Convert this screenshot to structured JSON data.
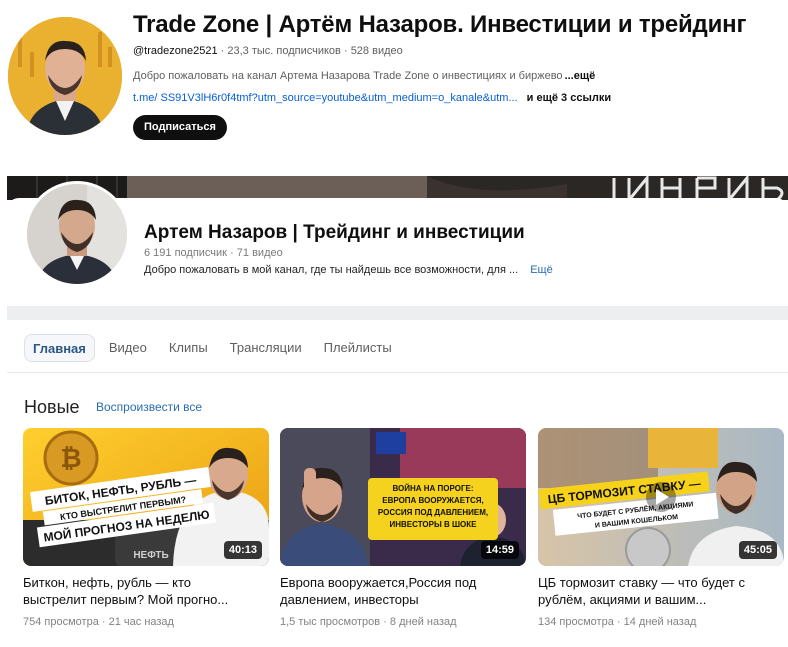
{
  "youtube": {
    "title": "Trade Zone | Артём Назаров. Инвестиции и трейдинг",
    "handle": "@tradezone2521",
    "subscribers": "23,3 тыс. подписчиков",
    "videos": "528 видео",
    "description": "Добро пожаловать на канал Артема Назарова Trade Zone о инвестициях и биржево",
    "more_label": "...ещё",
    "link": "t.me/ SS91V3lH6r0f4tmf?utm_source=youtube&utm_medium=o_kanale&utm...",
    "extra_links": "и ещё 3 ссылки",
    "subscribe_label": "Подписаться"
  },
  "channel": {
    "title": "Артем Назаров | Трейдинг и инвестиции",
    "subscribers": "6 191 подписчик",
    "videos": "71 видео",
    "description": "Добро пожаловать в мой канал, где ты найдешь все возможности, для ...",
    "more_label": "Ещё"
  },
  "tabs": [
    {
      "label": "Главная",
      "active": true
    },
    {
      "label": "Видео",
      "active": false
    },
    {
      "label": "Клипы",
      "active": false
    },
    {
      "label": "Трансляции",
      "active": false
    },
    {
      "label": "Плейлисты",
      "active": false
    }
  ],
  "section": {
    "title": "Новые",
    "play_all": "Воспроизвести все"
  },
  "videos": [
    {
      "title_line1": "Биткон, нефть, рубль — кто",
      "title_line2": "выстрелит первым? Мой прогно...",
      "views": "754 просмотра",
      "date": "21 час назад",
      "duration": "40:13",
      "thumb_text1": "БИТОК, НЕФТЬ, РУБЛЬ —",
      "thumb_text2": "КТО ВЫСТРЕЛИТ ПЕРВЫМ?",
      "thumb_text3": "МОЙ ПРОГНОЗ НА НЕДЕЛЮ",
      "thumb_text4": "НЕФТЬ"
    },
    {
      "title_line1": "Европа вооружается,Россия под",
      "title_line2": "давлением, инвесторы",
      "views": "1,5 тыс просмотров",
      "date": "8 дней назад",
      "duration": "14:59",
      "thumb_text1": "ВОЙНА НА ПОРОГЕ:",
      "thumb_text2": "ЕВРОПА ВООРУЖАЕТСЯ,",
      "thumb_text3": "РОССИЯ ПОД ДАВЛЕНИЕМ,",
      "thumb_text4": "ИНВЕСТОРЫ В ШОКЕ"
    },
    {
      "title_line1": "ЦБ тормозит ставку — что будет с",
      "title_line2": "рублём, акциями и вашим...",
      "views": "134 просмотра",
      "date": "14 дней назад",
      "duration": "45:05",
      "thumb_text1": "ЦБ ТОРМОЗИТ СТАВКУ —",
      "thumb_text2": "ЧТО БУДЕТ С РУБЛЁМ, АКЦИЯМИ",
      "thumb_text3": "И ВАШИМ КОШЕЛЬКОМ"
    }
  ],
  "meta_separator": "·",
  "colors": {
    "youtube_subscribe_bg": "#0f0f0f",
    "link_blue": "#065fd4",
    "vk_accent": "#2a5885",
    "thumb_yellow": "#f6d21a"
  }
}
